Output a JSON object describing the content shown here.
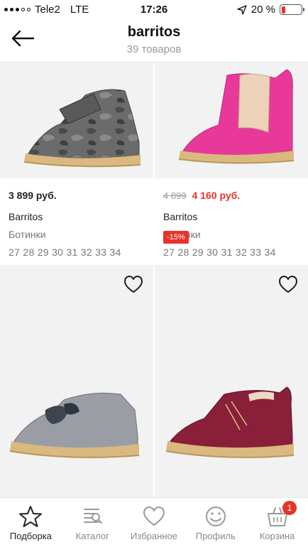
{
  "status": {
    "carrier": "Tele2",
    "network": "LTE",
    "time": "17:26",
    "battery": "20 %",
    "battery_level": 0.2
  },
  "header": {
    "title": "barritos",
    "subtitle": "39 товаров"
  },
  "products": [
    {
      "price": "3 899 руб.",
      "old_price": "",
      "discount": "",
      "brand": "Barritos",
      "category": "Ботинки",
      "sizes": "27 28 29 30 31 32 33 34"
    },
    {
      "price": "4 160 руб.",
      "old_price": "4 899",
      "discount": "-15%",
      "brand": "Barritos",
      "category": "Ботинки",
      "sizes": "27 28 29 30 31 32 33 34"
    }
  ],
  "tabs": [
    {
      "label": "Подборка",
      "icon": "star-icon"
    },
    {
      "label": "Каталог",
      "icon": "catalog-icon"
    },
    {
      "label": "Избранное",
      "icon": "heart-icon"
    },
    {
      "label": "Профиль",
      "icon": "smile-icon"
    },
    {
      "label": "Корзина",
      "icon": "cart-icon",
      "badge": "1"
    }
  ],
  "colors": {
    "accent": "#e63329",
    "muted": "#999999"
  }
}
